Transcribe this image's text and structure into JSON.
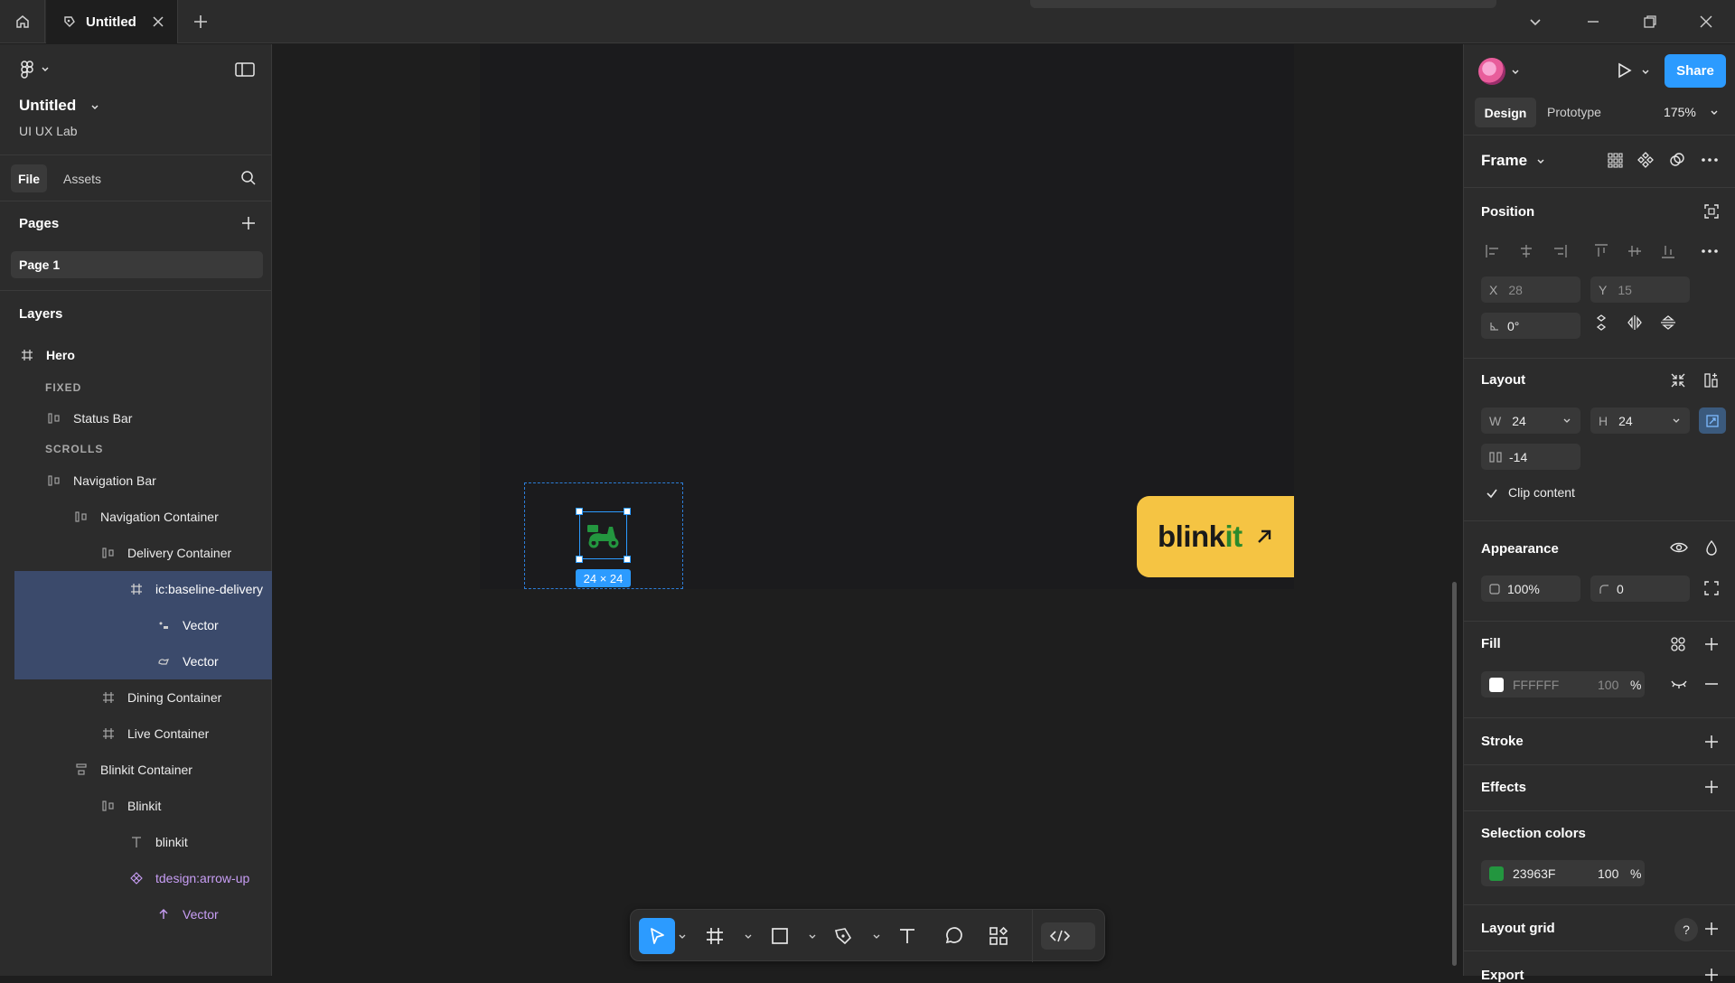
{
  "titlebar": {
    "tab_label": "Untitled",
    "new_tab": "+"
  },
  "left": {
    "file_title": "Untitled",
    "team": "UI UX Lab",
    "tabs": {
      "file": "File",
      "assets": "Assets"
    },
    "pages_header": "Pages",
    "pages": [
      "Page 1"
    ],
    "layers_header": "Layers",
    "sections": {
      "fixed": "FIXED",
      "scrolls": "SCROLLS"
    },
    "layers": [
      {
        "label": "Hero",
        "icon": "frame-icon"
      },
      {
        "label": "Status Bar",
        "icon": "autolayout-icon"
      },
      {
        "label": "Navigation Bar",
        "icon": "autolayout-icon"
      },
      {
        "label": "Navigation Container",
        "icon": "autolayout-icon"
      },
      {
        "label": "Delivery Container",
        "icon": "autolayout-icon"
      },
      {
        "label": "ic:baseline-delivery",
        "icon": "frame-icon",
        "selected": true
      },
      {
        "label": "Vector",
        "icon": "vector-icon",
        "selected": true
      },
      {
        "label": "Vector",
        "icon": "vector-icon",
        "selected": true
      },
      {
        "label": "Dining Container",
        "icon": "frame-icon"
      },
      {
        "label": "Live Container",
        "icon": "frame-icon"
      },
      {
        "label": "Blinkit Container",
        "icon": "vertical-autolayout-icon"
      },
      {
        "label": "Blinkit",
        "icon": "autolayout-icon"
      },
      {
        "label": "blinkit",
        "icon": "text-icon"
      },
      {
        "label": "tdesign:arrow-up",
        "icon": "component-icon",
        "purple": true
      },
      {
        "label": "Vector",
        "icon": "arrow-up-icon",
        "purple": true
      }
    ]
  },
  "canvas": {
    "size_badge": "24 × 24",
    "blinkit_text_main": "blink",
    "blinkit_text_accent": "it"
  },
  "right": {
    "share_label": "Share",
    "tabs": {
      "design": "Design",
      "prototype": "Prototype"
    },
    "zoom": "175%",
    "frame_label": "Frame",
    "position": {
      "header": "Position",
      "x_label": "X",
      "x_value": "28",
      "y_label": "Y",
      "y_value": "15",
      "rotation": "0°"
    },
    "layout": {
      "header": "Layout",
      "w_label": "W",
      "w_value": "24",
      "h_label": "H",
      "h_value": "24",
      "gap": "-14",
      "clip_content": "Clip content"
    },
    "appearance": {
      "header": "Appearance",
      "opacity": "100%",
      "radius": "0"
    },
    "fill": {
      "header": "Fill",
      "hex": "FFFFFF",
      "opacity": "100",
      "pct": "%"
    },
    "stroke_header": "Stroke",
    "effects_header": "Effects",
    "selection_colors": {
      "header": "Selection colors",
      "hex": "23963F",
      "opacity": "100",
      "pct": "%"
    },
    "layout_grid_header": "Layout grid",
    "help": "?",
    "export_header": "Export"
  },
  "colors": {
    "accent": "#2c9bff",
    "blinkit_yellow": "#f5c443",
    "delivery_green": "#23963F",
    "selected_layer": "#3b4a6b"
  }
}
